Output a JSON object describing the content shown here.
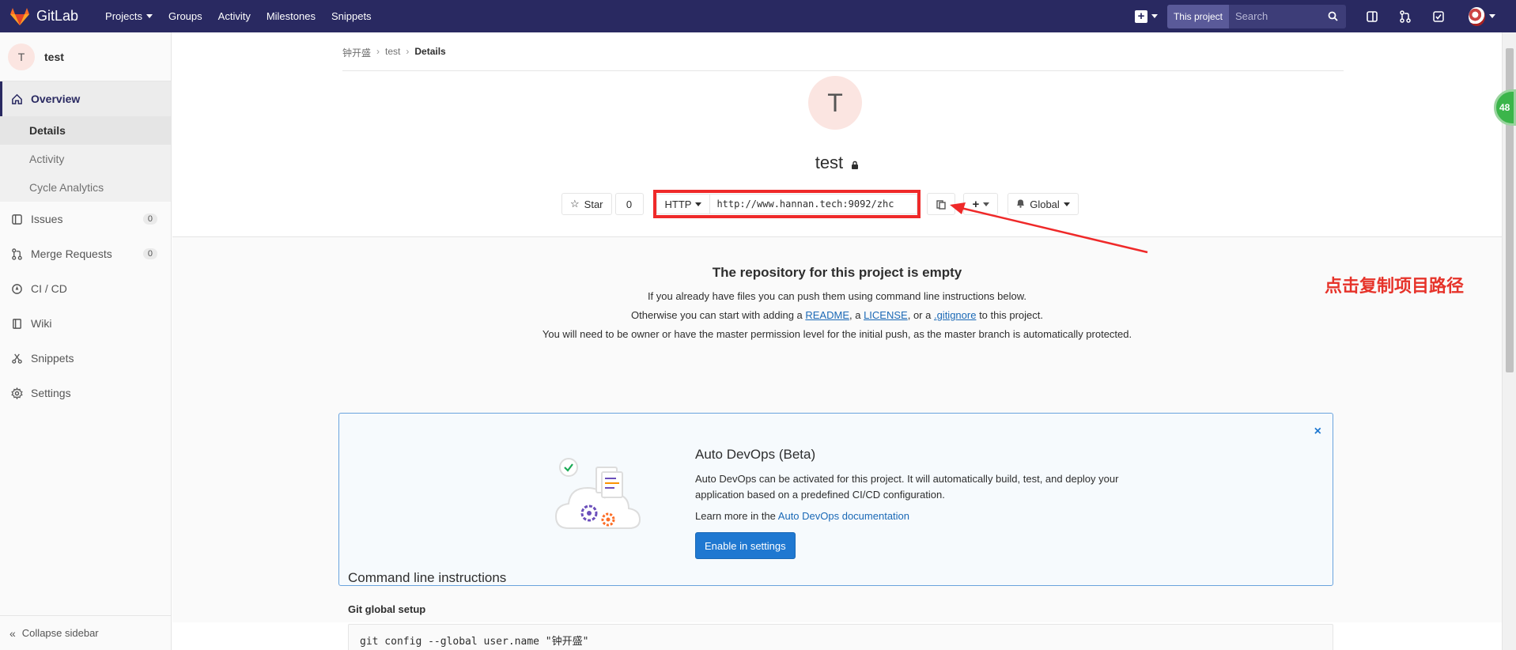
{
  "navbar": {
    "brand": "GitLab",
    "links": [
      "Projects",
      "Groups",
      "Activity",
      "Milestones",
      "Snippets"
    ],
    "search_scope": "This project",
    "search_placeholder": "Search",
    "colors": {
      "background": "#292961"
    }
  },
  "sidebar": {
    "project_initial": "T",
    "project_name": "test",
    "overview_label": "Overview",
    "overview_subitems": [
      "Details",
      "Activity",
      "Cycle Analytics"
    ],
    "issues_label": "Issues",
    "issues_count": "0",
    "merge_requests_label": "Merge Requests",
    "merge_requests_count": "0",
    "cicd_label": "CI / CD",
    "wiki_label": "Wiki",
    "snippets_label": "Snippets",
    "settings_label": "Settings",
    "collapse_label": "Collapse sidebar"
  },
  "breadcrumb": {
    "items": [
      "钟开盛",
      "test"
    ],
    "current": "Details"
  },
  "project": {
    "initial": "T",
    "name": "test",
    "star_label": "Star",
    "star_count": "0",
    "protocol": "HTTP",
    "clone_url": "http://www.hannan.tech:9092/zhc",
    "notification_label": "Global"
  },
  "annotation": {
    "text": "点击复制项目路径",
    "color": "#e6332a"
  },
  "empty_repo": {
    "title": "The repository for this project is empty",
    "line1": "If you already have files you can push them using command line instructions below.",
    "line2_pre": "Otherwise you can start with adding a ",
    "readme": "README",
    "line2_mid1": ", a ",
    "license": "LICENSE",
    "line2_mid2": ", or a ",
    "gitignore": ".gitignore",
    "line2_post": " to this project.",
    "line3": "You will need to be owner or have the master permission level for the initial push, as the master branch is automatically protected."
  },
  "auto_devops": {
    "title": "Auto DevOps (Beta)",
    "description": "Auto DevOps can be activated for this project. It will automatically build, test, and deploy your application based on a predefined CI/CD configuration.",
    "learn_pre": "Learn more in the ",
    "learn_link": "Auto DevOps documentation",
    "button": "Enable in settings",
    "close": "×"
  },
  "cli": {
    "title": "Command line instructions",
    "subtitle": "Git global setup",
    "code_line": "git config --global user.name \"钟开盛\""
  },
  "floating_badge": "48"
}
